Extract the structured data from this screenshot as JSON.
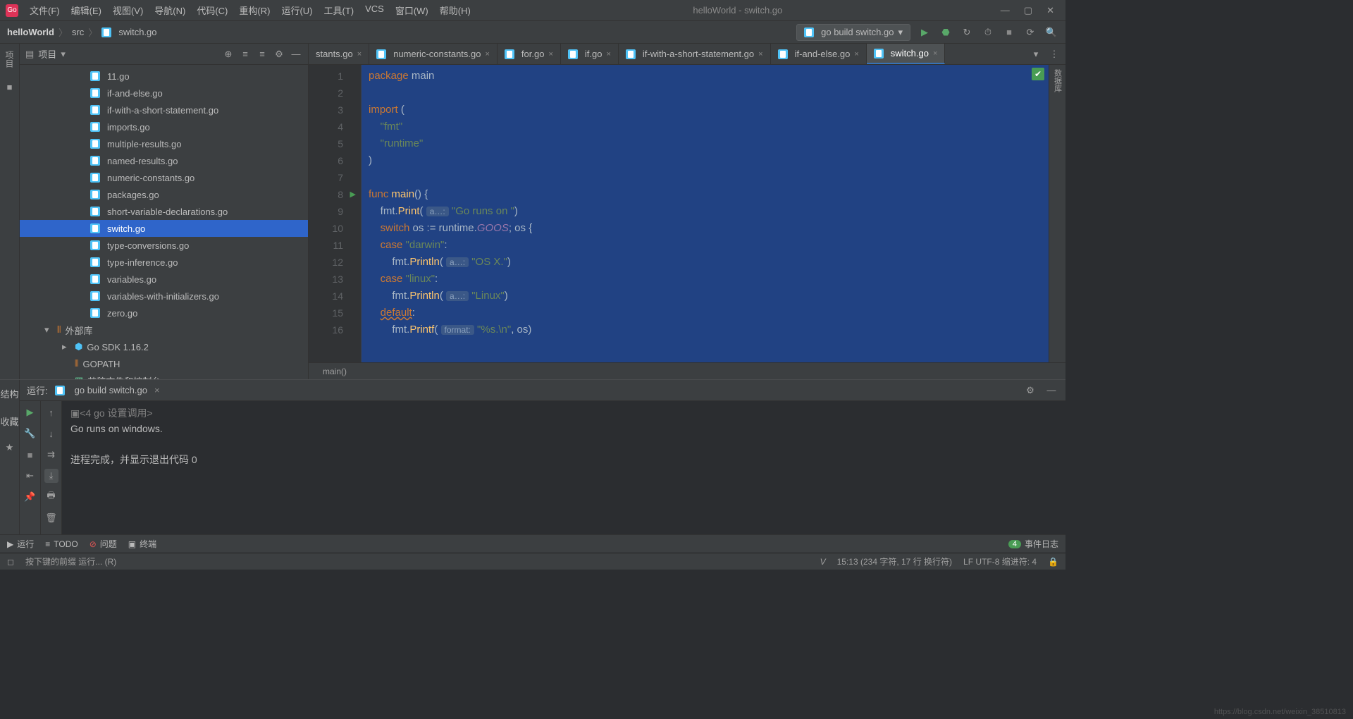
{
  "window": {
    "title": "helloWorld - switch.go"
  },
  "menu": {
    "file": "文件(F)",
    "edit": "编辑(E)",
    "view": "视图(V)",
    "nav": "导航(N)",
    "code": "代码(C)",
    "refactor": "重构(R)",
    "run": "运行(U)",
    "tools": "工具(T)",
    "vcs": "VCS",
    "window": "窗口(W)",
    "help": "帮助(H)"
  },
  "breadcrumb": {
    "project": "helloWorld",
    "dir": "src",
    "file": "switch.go"
  },
  "runConfig": {
    "label": "go build switch.go"
  },
  "projectPanel": {
    "title": "项目",
    "files": [
      "11.go",
      "if-and-else.go",
      "if-with-a-short-statement.go",
      "imports.go",
      "multiple-results.go",
      "named-results.go",
      "numeric-constants.go",
      "packages.go",
      "short-variable-declarations.go",
      "switch.go",
      "type-conversions.go",
      "type-inference.go",
      "variables.go",
      "variables-with-initializers.go",
      "zero.go"
    ],
    "selected": "switch.go",
    "externalLib": "外部库",
    "goSdk": "Go SDK 1.16.2",
    "gopath": "GOPATH <go>",
    "scratch": "草稿文件和控制台"
  },
  "tabs": {
    "items": [
      {
        "label": "stants.go",
        "partial": true
      },
      {
        "label": "numeric-constants.go"
      },
      {
        "label": "for.go"
      },
      {
        "label": "if.go"
      },
      {
        "label": "if-with-a-short-statement.go"
      },
      {
        "label": "if-and-else.go"
      },
      {
        "label": "switch.go",
        "active": true
      }
    ]
  },
  "code": {
    "lines": [
      {
        "n": 1,
        "t": [
          [
            "kw",
            "package"
          ],
          [
            "",
            " "
          ],
          [
            "ident",
            "main"
          ]
        ]
      },
      {
        "n": 2,
        "t": []
      },
      {
        "n": 3,
        "t": [
          [
            "kw",
            "import"
          ],
          [
            "",
            " ("
          ]
        ]
      },
      {
        "n": 4,
        "t": [
          [
            "",
            "    "
          ],
          [
            "str",
            "\"fmt\""
          ]
        ]
      },
      {
        "n": 5,
        "t": [
          [
            "",
            "    "
          ],
          [
            "str",
            "\"runtime\""
          ]
        ]
      },
      {
        "n": 6,
        "t": [
          [
            "",
            ")"
          ]
        ]
      },
      {
        "n": 7,
        "t": []
      },
      {
        "n": 8,
        "t": [
          [
            "kw",
            "func"
          ],
          [
            "",
            " "
          ],
          [
            "typ",
            "main"
          ],
          [
            "",
            "() {"
          ]
        ],
        "run": true
      },
      {
        "n": 9,
        "t": [
          [
            "",
            "    fmt."
          ],
          [
            "typ",
            "Print"
          ],
          [
            "",
            "( "
          ],
          [
            "hint",
            "a…:"
          ],
          [
            "",
            " "
          ],
          [
            "str",
            "\"Go runs on \""
          ],
          [
            "",
            ")"
          ]
        ]
      },
      {
        "n": 10,
        "t": [
          [
            "",
            "    "
          ],
          [
            "kw",
            "switch"
          ],
          [
            "",
            " os := runtime."
          ],
          [
            "pkg",
            "GOOS"
          ],
          [
            "",
            "; os {"
          ]
        ]
      },
      {
        "n": 11,
        "t": [
          [
            "",
            "    "
          ],
          [
            "kw",
            "case"
          ],
          [
            "",
            " "
          ],
          [
            "str",
            "\"darwin\""
          ],
          [
            "",
            ":"
          ]
        ]
      },
      {
        "n": 12,
        "t": [
          [
            "",
            "        fmt."
          ],
          [
            "typ",
            "Println"
          ],
          [
            "",
            "( "
          ],
          [
            "hint",
            "a…:"
          ],
          [
            "",
            " "
          ],
          [
            "str",
            "\"OS X.\""
          ],
          [
            "",
            ")"
          ]
        ]
      },
      {
        "n": 13,
        "t": [
          [
            "",
            "    "
          ],
          [
            "kw",
            "case"
          ],
          [
            "",
            " "
          ],
          [
            "str",
            "\"linux\""
          ],
          [
            "",
            ":"
          ]
        ]
      },
      {
        "n": 14,
        "t": [
          [
            "",
            "        fmt."
          ],
          [
            "typ",
            "Println"
          ],
          [
            "",
            "( "
          ],
          [
            "hint",
            "a…:"
          ],
          [
            "",
            " "
          ],
          [
            "str",
            "\"Linux\""
          ],
          [
            "",
            ")"
          ]
        ]
      },
      {
        "n": 15,
        "t": [
          [
            "",
            "    "
          ],
          [
            "kw wavy",
            "default"
          ],
          [
            "",
            ":"
          ]
        ],
        "bulb": true
      },
      {
        "n": 16,
        "t": [
          [
            "",
            "        fmt."
          ],
          [
            "typ",
            "Printf"
          ],
          [
            "",
            "( "
          ],
          [
            "hint",
            "format:"
          ],
          [
            "",
            " "
          ],
          [
            "str",
            "\"%s.\\n\""
          ],
          [
            "",
            ", os)"
          ]
        ]
      }
    ],
    "breadcrumb": "main()"
  },
  "runPanel": {
    "title": "运行:",
    "config": "go build switch.go",
    "cmdline": "<4 go 设置调用>",
    "output": "Go runs on windows.",
    "exit": "进程完成，并显示退出代码 0"
  },
  "bottomBar": {
    "run": "运行",
    "todo": "TODO",
    "problems": "问题",
    "terminal": "终端",
    "events": "事件日志",
    "eventsCount": "4"
  },
  "statusBar": {
    "hint": "按下键的前缀 运行... (R)",
    "pos": "15:13 (234 字符, 17 行 换行符)",
    "misc": "LF   UTF-8   缩进符: 4"
  },
  "leftStrip": {
    "project": "项目"
  },
  "leftBottom": {
    "struct": "结构",
    "fav": "收藏"
  },
  "rightStrip": {
    "db": "数据库"
  },
  "watermark": "https://blog.csdn.net/weixin_38510813"
}
